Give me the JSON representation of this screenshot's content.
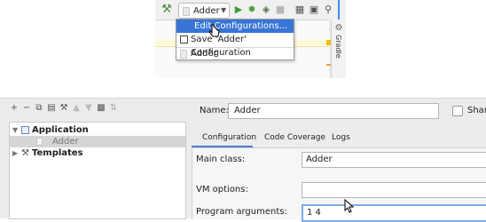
{
  "toolbar": {
    "run_config_name": "Adder",
    "icons": [
      "hammer-icon",
      "run-icon",
      "debug-icon",
      "coverage-icon",
      "stop-icon",
      "project-structure-icon",
      "frame-icon",
      "search-icon"
    ]
  },
  "side_panel": {
    "label": "Gradle"
  },
  "config_dropdown": {
    "items": [
      {
        "label": "Edit Configurations..."
      },
      {
        "label": "Save 'Adder' Configuration"
      },
      {
        "label": "Adder"
      }
    ]
  },
  "tree": {
    "application_label": "Application",
    "adder_label": "Adder",
    "templates_label": "Templates"
  },
  "form": {
    "name_label": "Name:",
    "name_value": "Adder",
    "share_label": "Share",
    "tabs": [
      {
        "label": "Configuration"
      },
      {
        "label": "Code Coverage"
      },
      {
        "label": "Logs"
      }
    ],
    "main_class_label": "Main class:",
    "main_class_value": "Adder",
    "vm_options_label": "VM options:",
    "vm_options_value": "",
    "program_arguments_label": "Program arguments:",
    "program_arguments_value": "1 4"
  },
  "colors": {
    "selection": "#3875d7",
    "focus": "#7ea9e8",
    "run_green": "#3c9c3c"
  }
}
